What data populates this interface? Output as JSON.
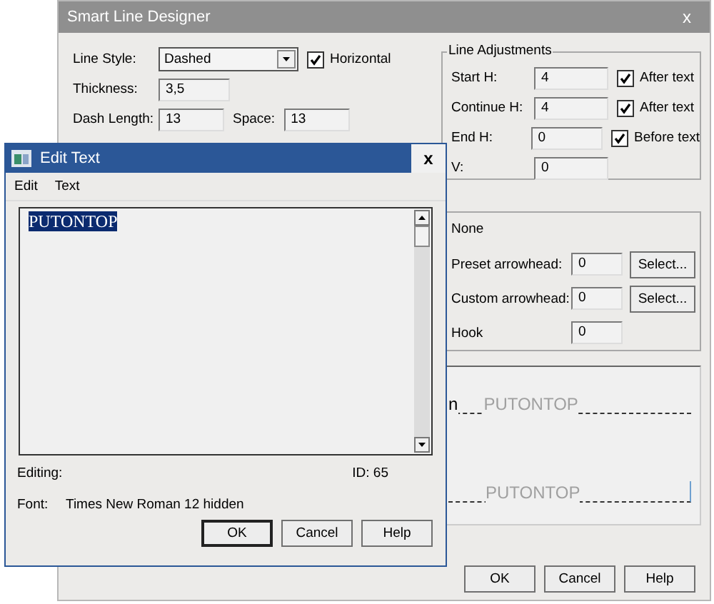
{
  "designer_window": {
    "title": "Smart Line Designer",
    "close": "x",
    "line_style": {
      "label": "Line Style:",
      "value": "Dashed"
    },
    "horizontal": {
      "label": "Horizontal",
      "checked": true
    },
    "thickness": {
      "label": "Thickness:",
      "value": "3,5"
    },
    "dash_length": {
      "label": "Dash Length:",
      "value": "13"
    },
    "space": {
      "label": "Space:",
      "value": "13"
    },
    "line_adjustments": {
      "title": "Line Adjustments",
      "rows": [
        {
          "label": "Start H:",
          "value": "4",
          "checkbox": {
            "label": "After text",
            "checked": true
          }
        },
        {
          "label": "Continue H:",
          "value": "4",
          "checkbox": {
            "label": "After text",
            "checked": true
          }
        },
        {
          "label": "End H:",
          "value": "0",
          "checkbox": {
            "label": "Before text",
            "checked": true
          }
        },
        {
          "label": "V:",
          "value": "0"
        }
      ]
    },
    "arrowheads": {
      "style": "None",
      "rows": [
        {
          "label": "Preset arrowhead:",
          "value": "0",
          "button": "Select..."
        },
        {
          "label": "Custom arrowhead:",
          "value": "0",
          "button": "Select..."
        },
        {
          "label": "Hook",
          "value": "0"
        }
      ]
    },
    "preview": {
      "lead": "n",
      "lines": [
        "PUTONTOP",
        "PUTONTOP"
      ]
    },
    "buttons": [
      "OK",
      "Cancel",
      "Help"
    ]
  },
  "edit_text_window": {
    "title": "Edit Text",
    "close": "x",
    "menu": [
      "Edit",
      "Text"
    ],
    "text": "PUTONTOP",
    "editing_label": "Editing:",
    "id": "ID: 65",
    "font_label": "Font:",
    "font": "Times New Roman 12 hidden",
    "buttons": [
      "OK",
      "Cancel",
      "Help"
    ]
  }
}
